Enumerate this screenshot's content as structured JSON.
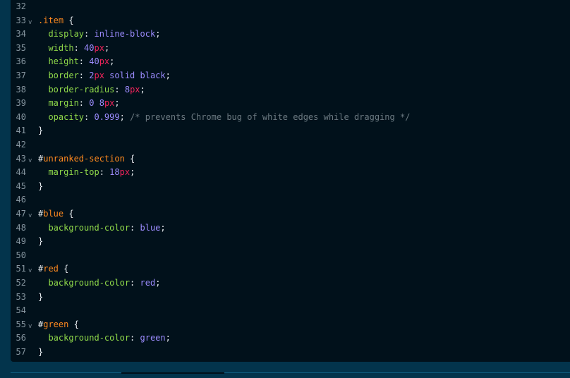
{
  "editor": {
    "lines": [
      {
        "n": "32",
        "fold": false,
        "tokens": []
      },
      {
        "n": "33",
        "fold": true,
        "tokens": [
          {
            "t": ".item",
            "c": "sel"
          },
          {
            "t": " {",
            "c": "punct"
          }
        ]
      },
      {
        "n": "34",
        "fold": false,
        "tokens": [
          {
            "t": "  display",
            "c": "prop"
          },
          {
            "t": ": ",
            "c": "punct"
          },
          {
            "t": "inline-block",
            "c": "val"
          },
          {
            "t": ";",
            "c": "punct"
          }
        ]
      },
      {
        "n": "35",
        "fold": false,
        "tokens": [
          {
            "t": "  width",
            "c": "prop"
          },
          {
            "t": ": ",
            "c": "punct"
          },
          {
            "t": "40",
            "c": "val"
          },
          {
            "t": "px",
            "c": "unit"
          },
          {
            "t": ";",
            "c": "punct"
          }
        ]
      },
      {
        "n": "36",
        "fold": false,
        "tokens": [
          {
            "t": "  height",
            "c": "prop"
          },
          {
            "t": ": ",
            "c": "punct"
          },
          {
            "t": "40",
            "c": "val"
          },
          {
            "t": "px",
            "c": "unit"
          },
          {
            "t": ";",
            "c": "punct"
          }
        ]
      },
      {
        "n": "37",
        "fold": false,
        "tokens": [
          {
            "t": "  border",
            "c": "prop"
          },
          {
            "t": ": ",
            "c": "punct"
          },
          {
            "t": "2",
            "c": "val"
          },
          {
            "t": "px",
            "c": "unit"
          },
          {
            "t": " solid black",
            "c": "val"
          },
          {
            "t": ";",
            "c": "punct"
          }
        ]
      },
      {
        "n": "38",
        "fold": false,
        "tokens": [
          {
            "t": "  border-radius",
            "c": "prop"
          },
          {
            "t": ": ",
            "c": "punct"
          },
          {
            "t": "8",
            "c": "val"
          },
          {
            "t": "px",
            "c": "unit"
          },
          {
            "t": ";",
            "c": "punct"
          }
        ]
      },
      {
        "n": "39",
        "fold": false,
        "tokens": [
          {
            "t": "  margin",
            "c": "prop"
          },
          {
            "t": ": ",
            "c": "punct"
          },
          {
            "t": "0 8",
            "c": "val"
          },
          {
            "t": "px",
            "c": "unit"
          },
          {
            "t": ";",
            "c": "punct"
          }
        ]
      },
      {
        "n": "40",
        "fold": false,
        "tokens": [
          {
            "t": "  opacity",
            "c": "prop"
          },
          {
            "t": ": ",
            "c": "punct"
          },
          {
            "t": "0.999",
            "c": "val"
          },
          {
            "t": "; ",
            "c": "punct"
          },
          {
            "t": "/* prevents Chrome bug of white edges while dragging */",
            "c": "com"
          }
        ]
      },
      {
        "n": "41",
        "fold": false,
        "tokens": [
          {
            "t": "}",
            "c": "punct"
          }
        ]
      },
      {
        "n": "42",
        "fold": false,
        "tokens": []
      },
      {
        "n": "43",
        "fold": true,
        "tokens": [
          {
            "t": "#",
            "c": "punct"
          },
          {
            "t": "unranked-section",
            "c": "sel"
          },
          {
            "t": " {",
            "c": "punct"
          }
        ]
      },
      {
        "n": "44",
        "fold": false,
        "tokens": [
          {
            "t": "  margin-top",
            "c": "prop"
          },
          {
            "t": ": ",
            "c": "punct"
          },
          {
            "t": "18",
            "c": "val"
          },
          {
            "t": "px",
            "c": "unit"
          },
          {
            "t": ";",
            "c": "punct"
          }
        ]
      },
      {
        "n": "45",
        "fold": false,
        "tokens": [
          {
            "t": "}",
            "c": "punct"
          }
        ]
      },
      {
        "n": "46",
        "fold": false,
        "tokens": []
      },
      {
        "n": "47",
        "fold": true,
        "tokens": [
          {
            "t": "#",
            "c": "punct"
          },
          {
            "t": "blue",
            "c": "sel"
          },
          {
            "t": " {",
            "c": "punct"
          }
        ]
      },
      {
        "n": "48",
        "fold": false,
        "tokens": [
          {
            "t": "  background-color",
            "c": "prop"
          },
          {
            "t": ": ",
            "c": "punct"
          },
          {
            "t": "blue",
            "c": "val"
          },
          {
            "t": ";",
            "c": "punct"
          }
        ]
      },
      {
        "n": "49",
        "fold": false,
        "tokens": [
          {
            "t": "}",
            "c": "punct"
          }
        ]
      },
      {
        "n": "50",
        "fold": false,
        "tokens": []
      },
      {
        "n": "51",
        "fold": true,
        "tokens": [
          {
            "t": "#",
            "c": "punct"
          },
          {
            "t": "red",
            "c": "sel"
          },
          {
            "t": " {",
            "c": "punct"
          }
        ]
      },
      {
        "n": "52",
        "fold": false,
        "tokens": [
          {
            "t": "  background-color",
            "c": "prop"
          },
          {
            "t": ": ",
            "c": "punct"
          },
          {
            "t": "red",
            "c": "val"
          },
          {
            "t": ";",
            "c": "punct"
          }
        ]
      },
      {
        "n": "53",
        "fold": false,
        "tokens": [
          {
            "t": "}",
            "c": "punct"
          }
        ]
      },
      {
        "n": "54",
        "fold": false,
        "tokens": []
      },
      {
        "n": "55",
        "fold": true,
        "tokens": [
          {
            "t": "#",
            "c": "punct"
          },
          {
            "t": "green",
            "c": "sel"
          },
          {
            "t": " {",
            "c": "punct"
          }
        ]
      },
      {
        "n": "56",
        "fold": false,
        "tokens": [
          {
            "t": "  background-color",
            "c": "prop"
          },
          {
            "t": ": ",
            "c": "punct"
          },
          {
            "t": "green",
            "c": "val"
          },
          {
            "t": ";",
            "c": "punct"
          }
        ]
      },
      {
        "n": "57",
        "fold": false,
        "tokens": [
          {
            "t": "}",
            "c": "punct"
          }
        ]
      }
    ],
    "fold_glyph": "v"
  }
}
